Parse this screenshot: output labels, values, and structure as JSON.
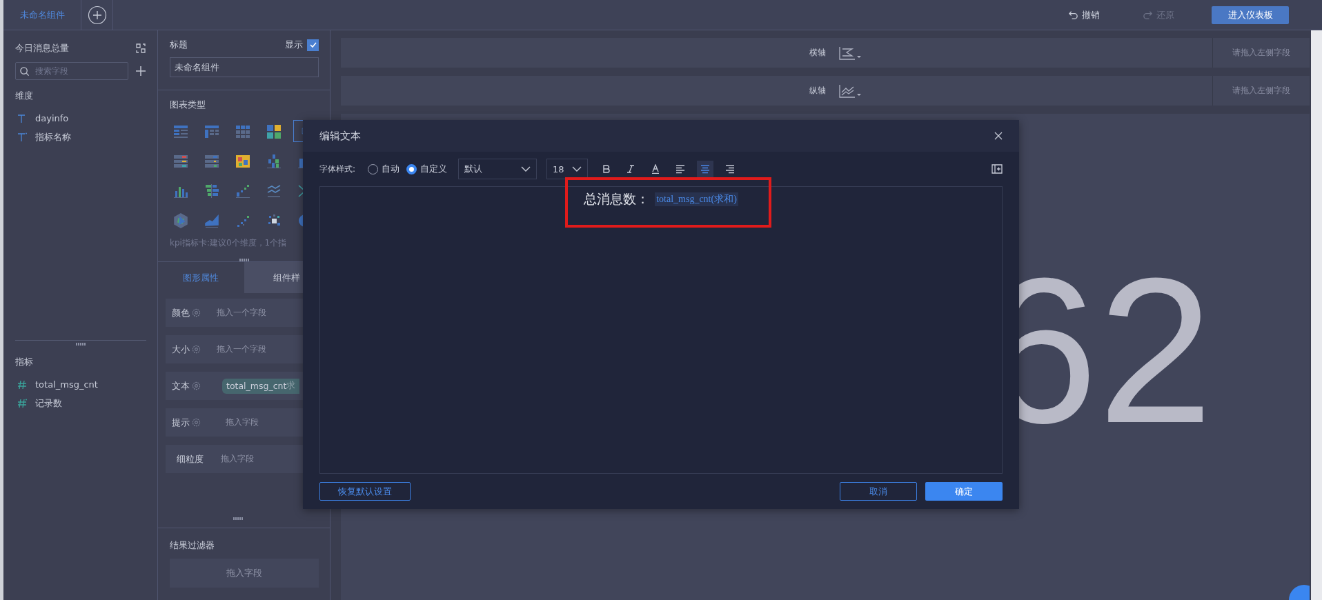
{
  "tabs": [
    {
      "label": "未命名组件",
      "selected": true
    }
  ],
  "toolbar": {
    "actions": [
      {
        "kind": "undo",
        "label": "撤销",
        "disabled": false
      },
      {
        "kind": "redo",
        "label": "还原",
        "disabled": true
      }
    ],
    "primary_button": "进入仪表板"
  },
  "fields_panel": {
    "title": "今日消息总量",
    "search": {
      "placeholder": "搜索字段"
    },
    "sections": [
      {
        "heading": "维度",
        "items": [
          {
            "kind": "text",
            "name": "dayinfo"
          },
          {
            "kind": "text-calc",
            "name": "指标名称"
          }
        ]
      },
      {
        "heading": "指标",
        "items": [
          {
            "kind": "number",
            "name": "total_msg_cnt"
          },
          {
            "kind": "number-calc",
            "name": "记录数"
          }
        ]
      }
    ]
  },
  "settings_panel": {
    "title_label": "标题",
    "show_label": "显示",
    "show_checked": true,
    "title_value": "未命名组件",
    "chart_types_heading": "图表类型",
    "chart_types": [
      {
        "kind": "table",
        "selected": false
      },
      {
        "kind": "cross-table",
        "selected": false
      },
      {
        "kind": "grid",
        "selected": false
      },
      {
        "kind": "treemap",
        "selected": false
      },
      {
        "kind": "kpi",
        "selected": true
      },
      {
        "kind": "color-table",
        "selected": false
      },
      {
        "kind": "dot-table",
        "selected": false
      },
      {
        "kind": "heatmap",
        "selected": false
      },
      {
        "kind": "stacked-bar",
        "selected": false
      },
      {
        "kind": "bar-small",
        "selected": false
      },
      {
        "kind": "bar",
        "selected": false
      },
      {
        "kind": "split-bar",
        "selected": false
      },
      {
        "kind": "step",
        "selected": false
      },
      {
        "kind": "multi-line",
        "selected": false
      },
      {
        "kind": "funnel",
        "selected": false
      },
      {
        "kind": "radar",
        "selected": false
      },
      {
        "kind": "area",
        "selected": false
      },
      {
        "kind": "scatter",
        "selected": false
      },
      {
        "kind": "bubble",
        "selected": false
      },
      {
        "kind": "pie",
        "selected": false
      }
    ],
    "chart_hint": "kpi指标卡:建议0个维度，1个指",
    "tabs": [
      {
        "label": "图形属性",
        "selected": true
      },
      {
        "label": "组件样",
        "selected": false
      }
    ],
    "properties": [
      {
        "label": "颜色",
        "settings": true,
        "hint": "拖入一个字段"
      },
      {
        "label": "大小",
        "settings": true,
        "hint": "拖入一个字段"
      },
      {
        "label": "文本",
        "settings": true,
        "chip": "total_msg_cnt",
        "chip_note": "求"
      },
      {
        "label": "提示",
        "settings": true,
        "hint": "拖入字段"
      },
      {
        "label": "细粒度",
        "settings": false,
        "hint": "拖入字段"
      }
    ],
    "filter_heading": "结果过滤器",
    "filter_hint": "拖入字段"
  },
  "canvas": {
    "axes": [
      {
        "kind": "x",
        "label": "横轴",
        "hint": "请拖入左侧字段"
      },
      {
        "kind": "y",
        "label": "纵轴",
        "hint": "请拖入左侧字段"
      }
    ],
    "value": "62"
  },
  "dialog": {
    "title": "编辑文本",
    "font_style_label": "字体样式:",
    "modes": [
      {
        "label": "自动",
        "selected": false
      },
      {
        "label": "自定义",
        "selected": true
      }
    ],
    "font": "默认",
    "size": "18",
    "format_buttons": [
      {
        "kind": "bold",
        "selected": false
      },
      {
        "kind": "italic",
        "selected": false
      },
      {
        "kind": "color",
        "selected": false
      },
      {
        "kind": "align-left",
        "selected": false
      },
      {
        "kind": "align-center",
        "selected": true
      },
      {
        "kind": "align-right",
        "selected": false
      }
    ],
    "content": {
      "text": "总消息数：",
      "field": "total_msg_cnt(求和)",
      "highlighted": true
    },
    "reset_button": "恢复默认设置",
    "cancel_button": "取消",
    "ok_button": "确定"
  }
}
